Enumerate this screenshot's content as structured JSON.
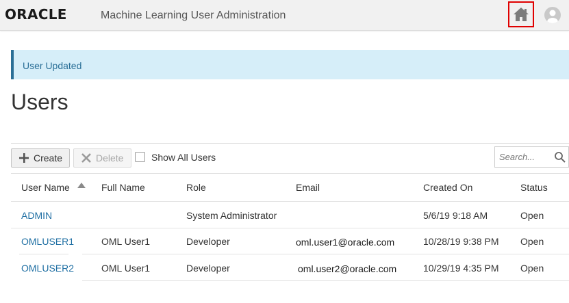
{
  "header": {
    "logo": "ORACLE",
    "title": "Machine Learning User Administration"
  },
  "banner": {
    "message": "User Updated"
  },
  "page": {
    "title": "Users"
  },
  "toolbar": {
    "create_label": "Create",
    "delete_label": "Delete",
    "show_all_label": "Show All Users",
    "show_all_checked": false,
    "search_placeholder": "Search...",
    "search_value": ""
  },
  "table": {
    "columns": [
      "User Name",
      "Full Name",
      "Role",
      "Email",
      "Created On",
      "Status"
    ],
    "sorted_column": "User Name",
    "sort_direction": "ascending",
    "rows": [
      {
        "user_name": "ADMIN",
        "full_name": "",
        "role": "System Administrator",
        "email": "",
        "created_on": "5/6/19 9:18 AM",
        "status": "Open"
      },
      {
        "user_name": "OMLUSER1",
        "full_name": "OML User1",
        "role": "Developer",
        "email": "oml.user1@oracle.com",
        "created_on": "10/28/19 9:38 PM",
        "status": "Open"
      },
      {
        "user_name": "OMLUSER2",
        "full_name": "OML User1",
        "role": "Developer",
        "email": "oml.user2@oracle.com",
        "created_on": "10/29/19 4:35 PM",
        "status": "Open"
      }
    ]
  },
  "colors": {
    "accent_link": "#1f6fa3",
    "banner_bg": "#d6eef9",
    "highlight_box": "#e00000"
  }
}
